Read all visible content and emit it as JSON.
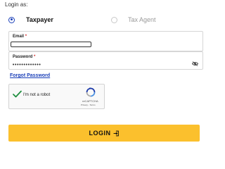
{
  "login_as_label": "Login as:",
  "roles": [
    {
      "label": "Taxpayer",
      "selected": true
    },
    {
      "label": "Tax Agent",
      "selected": false
    }
  ],
  "email": {
    "label": "Email",
    "required_mark": "*",
    "value": ""
  },
  "password": {
    "label": "Password",
    "required_mark": "*",
    "value": "•••••••••••••",
    "visibility_icon": "eye-slash-icon"
  },
  "forgot_password_label": "Forgot Password",
  "captcha": {
    "label": "I'm not a robot",
    "brand": "reCAPTCHA",
    "terms": "Privacy - Terms",
    "checked": true
  },
  "login_button": {
    "label": "LOGIN",
    "icon": "login-arrow-icon"
  },
  "colors": {
    "accent": "#1a3fb8",
    "button": "#fbc02d",
    "required": "#d32f2f",
    "check": "#1e8e3e"
  }
}
